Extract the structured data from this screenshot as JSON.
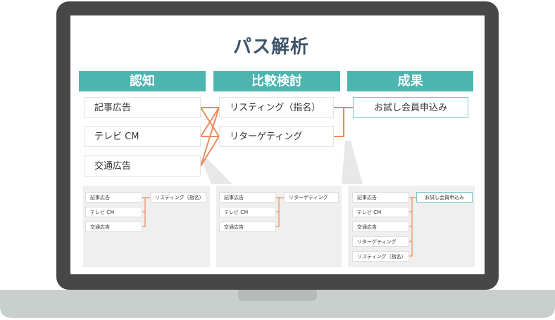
{
  "title": "パス解析",
  "columns": [
    {
      "header": "認知",
      "items": [
        "記事広告",
        "テレビ CM",
        "交通広告"
      ]
    },
    {
      "header": "比較検討",
      "items": [
        "リスティング（指名）",
        "リターゲティング"
      ]
    },
    {
      "header": "成果",
      "items": [
        "お試し会員申込み"
      ]
    }
  ],
  "panels": [
    {
      "sources": [
        "記事広告",
        "テレビ CM",
        "交通広告"
      ],
      "target": "リスティング（指名）"
    },
    {
      "sources": [
        "記事広告",
        "テレビ CM",
        "交通広告"
      ],
      "target": "リターゲティング"
    },
    {
      "sources": [
        "記事広告",
        "テレビ CM",
        "交通広告",
        "リターゲティング",
        "リスティング（指名）"
      ],
      "target": "お試し会員申込み"
    }
  ],
  "colors": {
    "header": "#4db5b0",
    "connector": "#e98a5c",
    "title": "#3e556b",
    "laptop_frame": "#474747",
    "laptop_base": "#c9cfcd",
    "panel_bg": "#efefef",
    "goal_border": "#7cc9c4"
  }
}
